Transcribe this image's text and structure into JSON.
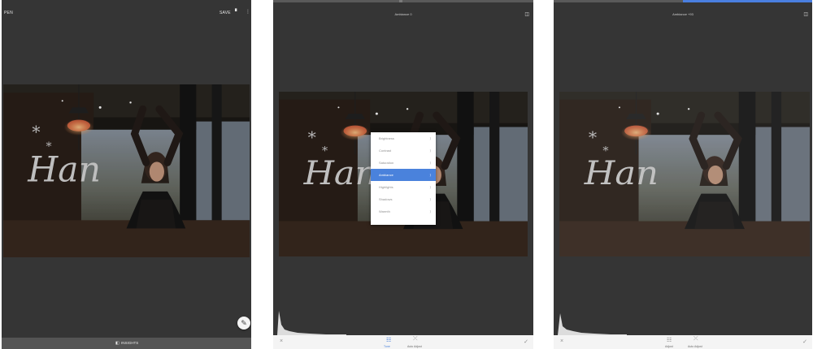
{
  "screen1": {
    "open_label": "PEN",
    "save_label": "SAVE",
    "bottom_label": "INSIGHTS"
  },
  "screen2": {
    "title": "Ambiance 0",
    "menu": [
      {
        "label": "Brightness",
        "selected": false
      },
      {
        "label": "Contrast",
        "selected": false
      },
      {
        "label": "Saturation",
        "selected": false
      },
      {
        "label": "Ambiance",
        "selected": true
      },
      {
        "label": "Highlights",
        "selected": false
      },
      {
        "label": "Shadows",
        "selected": false
      },
      {
        "label": "Warmth",
        "selected": false
      }
    ],
    "tools": [
      {
        "label": "Tune",
        "icon": "tune-icon"
      },
      {
        "label": "Auto Adjust",
        "icon": "magic-icon"
      }
    ]
  },
  "screen3": {
    "title": "Ambiance +93",
    "tools": [
      {
        "label": "Adjust",
        "icon": "tune-icon"
      },
      {
        "label": "Auto Adjust",
        "icon": "magic-icon"
      }
    ],
    "slider_progress": 0.45
  },
  "colors": {
    "panel": "#353535",
    "accent": "#4a82dc",
    "bottom_bar": "#f4f4f4"
  }
}
